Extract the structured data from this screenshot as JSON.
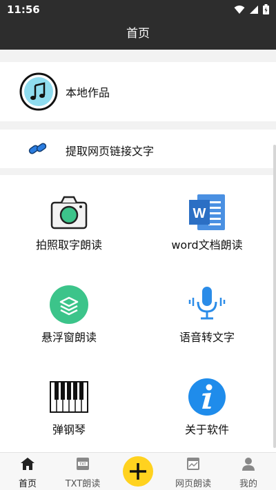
{
  "status": {
    "time": "11:56"
  },
  "appbar": {
    "title": "首页"
  },
  "top_items": [
    {
      "label": "本地作品",
      "icon": "music-note-icon"
    },
    {
      "label": "提取网页链接文字",
      "icon": "link-icon"
    }
  ],
  "grid": [
    {
      "label": "拍照取字朗读",
      "icon": "camera-icon"
    },
    {
      "label": "word文档朗读",
      "icon": "word-doc-icon"
    },
    {
      "label": "悬浮窗朗读",
      "icon": "layers-icon"
    },
    {
      "label": "语音转文字",
      "icon": "microphone-icon"
    },
    {
      "label": "弹钢琴",
      "icon": "piano-icon"
    },
    {
      "label": "关于软件",
      "icon": "info-icon"
    }
  ],
  "tabs": [
    {
      "label": "首页",
      "icon": "home-icon"
    },
    {
      "label": "TXT朗读",
      "icon": "txt-file-icon"
    },
    {
      "label": "",
      "icon": "plus-icon"
    },
    {
      "label": "网页朗读",
      "icon": "webpage-icon"
    },
    {
      "label": "我的",
      "icon": "person-icon"
    }
  ],
  "colors": {
    "bar": "#2d2d2d",
    "accent_yellow": "#ffd21f",
    "blue": "#2b8ce8",
    "green": "#3cc48a"
  }
}
